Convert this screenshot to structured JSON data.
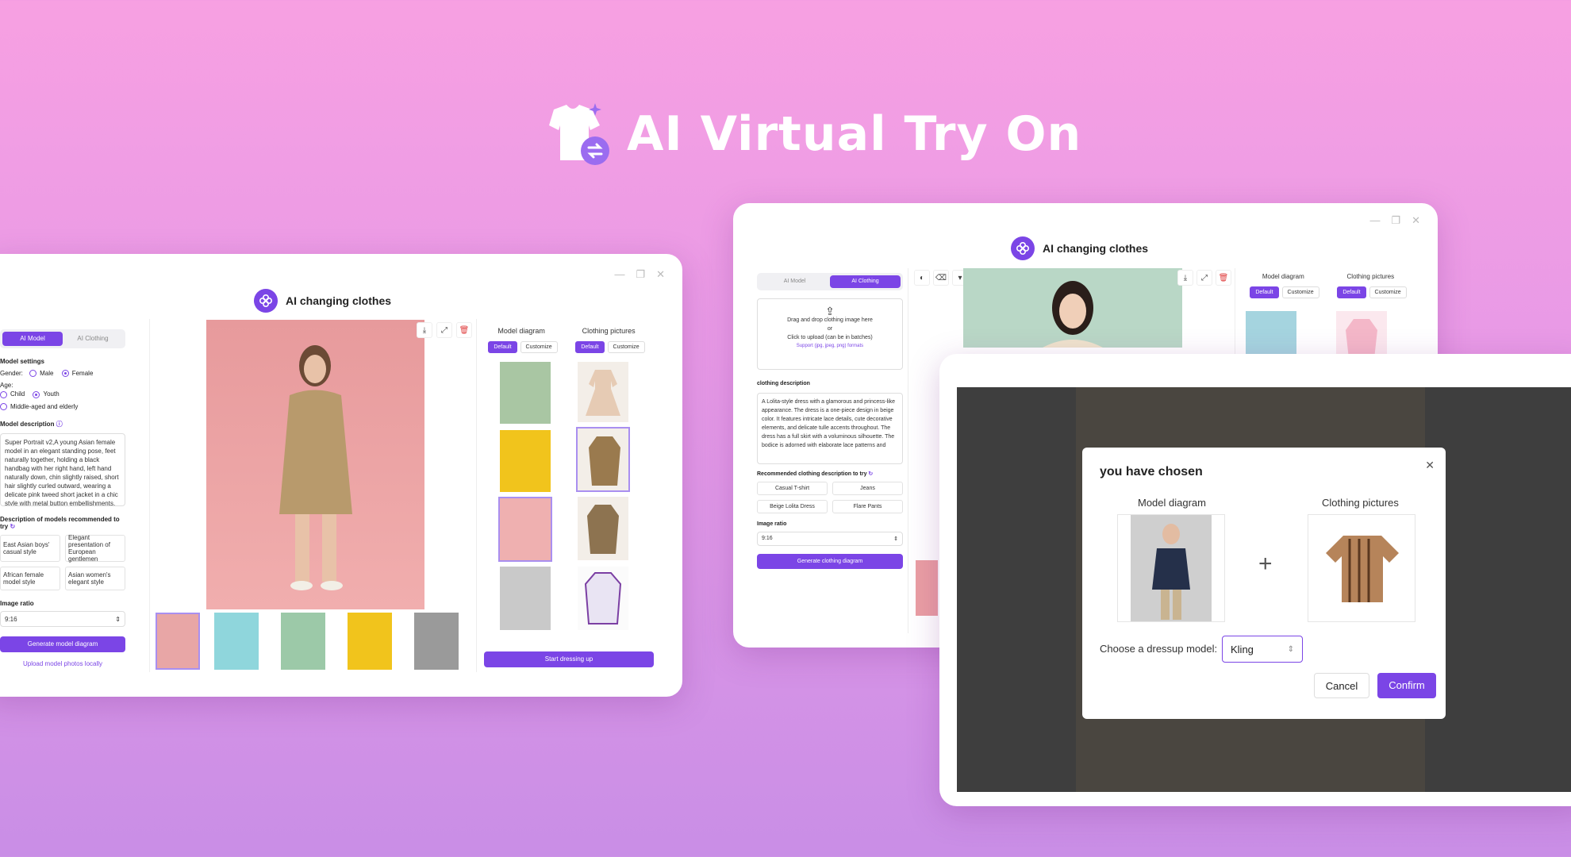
{
  "hero": {
    "title": "AI Virtual Try On"
  },
  "app": {
    "title": "AI changing clothes"
  },
  "left_window": {
    "tabs": [
      "AI Model",
      "AI Clothing"
    ],
    "model_settings_label": "Model settings",
    "gender_label": "Gender:",
    "gender_options": [
      "Male",
      "Female"
    ],
    "age_label": "Age:",
    "age_options": [
      "Child",
      "Youth",
      "Middle-aged and elderly"
    ],
    "model_description_label": "Model description",
    "model_description_text": "Super Portrait v2,A young Asian female model in an elegant standing pose, feet naturally together, holding a black handbag with her right hand, left hand naturally down, chin slightly raised, short hair slightly curled outward, wearing a delicate pink tweed short jacket in a chic style with metal button embellishments, white top, black short skirt",
    "recommended_label": "Description of models recommended to try",
    "recommended_items": [
      "East Asian boys' casual style",
      "Elegant presentation of European gentlemen",
      "African female model style",
      "Asian women's elegant style"
    ],
    "ratio_label": "Image ratio",
    "ratio_value": "9:16",
    "generate_button": "Generate model diagram",
    "upload_link": "Upload model photos locally",
    "model_diagram_label": "Model diagram",
    "clothing_pictures_label": "Clothing pictures",
    "preset_default": "Default",
    "preset_customize": "Customize",
    "start_button": "Start dressing up"
  },
  "right_window": {
    "tabs": [
      "AI Model",
      "AI Clothing"
    ],
    "upload_line1": "Drag and drop clothing image here",
    "upload_or": "or",
    "upload_line2": "Click to upload (can be in batches)",
    "upload_formats": "Support (jpg, jpeg, png) formats",
    "clothing_description_label": "clothing description",
    "clothing_description_text": "A Lolita-style dress with a glamorous and princess-like appearance. The dress is a one-piece design in beige color. It features intricate lace details, cute decorative elements, and delicate tulle accents throughout. The dress has a full skirt with a voluminous silhouette. The bodice is adorned with elaborate lace patterns and",
    "recommended_label": "Recommended clothing description to try",
    "recommended_items": [
      "Casual T-shirt",
      "Jeans",
      "Beige Lolita Dress",
      "Flare Pants"
    ],
    "ratio_label": "Image ratio",
    "ratio_value": "9:16",
    "generate_button": "Generate clothing diagram",
    "model_diagram_label": "Model diagram",
    "clothing_pictures_label": "Clothing pictures",
    "preset_default": "Default",
    "preset_customize": "Customize"
  },
  "dialog": {
    "title": "you have chosen",
    "model_label": "Model diagram",
    "clothing_label": "Clothing pictures",
    "plus": "+",
    "choose_label": "Choose a dressup model:",
    "model_select": "Kling",
    "cancel": "Cancel",
    "confirm": "Confirm"
  },
  "colors": {
    "accent": "#7b45e6",
    "bg_top": "#f7a0e2",
    "bg_bottom": "#c98ee6"
  }
}
